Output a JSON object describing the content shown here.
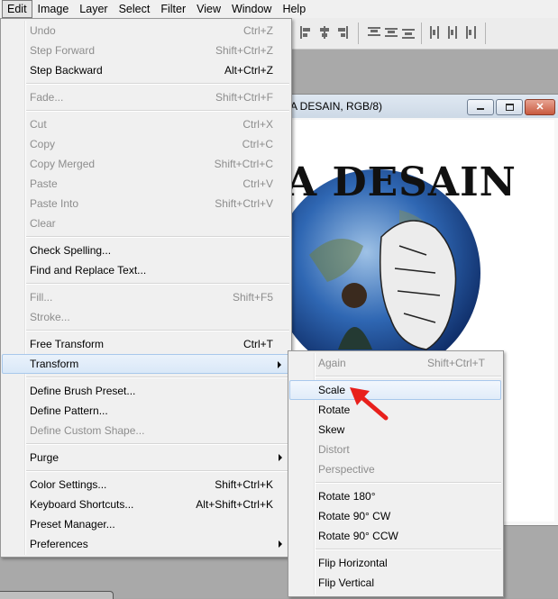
{
  "menubar": {
    "items": [
      "Edit",
      "Image",
      "Layer",
      "Select",
      "Filter",
      "View",
      "Window",
      "Help"
    ]
  },
  "document": {
    "title": "A DESAIN, RGB/8)",
    "artwork_text": "A DESAIN"
  },
  "edit_menu": {
    "items": [
      {
        "label": "Undo",
        "shortcut": "Ctrl+Z",
        "disabled": true
      },
      {
        "label": "Step Forward",
        "shortcut": "Shift+Ctrl+Z",
        "disabled": true
      },
      {
        "label": "Step Backward",
        "shortcut": "Alt+Ctrl+Z",
        "disabled": false
      },
      {
        "label": "Fade...",
        "shortcut": "Shift+Ctrl+F",
        "disabled": true
      },
      {
        "label": "Cut",
        "shortcut": "Ctrl+X",
        "disabled": true
      },
      {
        "label": "Copy",
        "shortcut": "Ctrl+C",
        "disabled": true
      },
      {
        "label": "Copy Merged",
        "shortcut": "Shift+Ctrl+C",
        "disabled": true
      },
      {
        "label": "Paste",
        "shortcut": "Ctrl+V",
        "disabled": true
      },
      {
        "label": "Paste Into",
        "shortcut": "Shift+Ctrl+V",
        "disabled": true
      },
      {
        "label": "Clear",
        "shortcut": "",
        "disabled": true
      },
      {
        "label": "Check Spelling...",
        "shortcut": "",
        "disabled": false
      },
      {
        "label": "Find and Replace Text...",
        "shortcut": "",
        "disabled": false
      },
      {
        "label": "Fill...",
        "shortcut": "Shift+F5",
        "disabled": true
      },
      {
        "label": "Stroke...",
        "shortcut": "",
        "disabled": true
      },
      {
        "label": "Free Transform",
        "shortcut": "Ctrl+T",
        "disabled": false
      },
      {
        "label": "Transform",
        "shortcut": "",
        "disabled": false
      },
      {
        "label": "Define Brush Preset...",
        "shortcut": "",
        "disabled": false
      },
      {
        "label": "Define Pattern...",
        "shortcut": "",
        "disabled": false
      },
      {
        "label": "Define Custom Shape...",
        "shortcut": "",
        "disabled": true
      },
      {
        "label": "Purge",
        "shortcut": "",
        "disabled": false
      },
      {
        "label": "Color Settings...",
        "shortcut": "Shift+Ctrl+K",
        "disabled": false
      },
      {
        "label": "Keyboard Shortcuts...",
        "shortcut": "Alt+Shift+Ctrl+K",
        "disabled": false
      },
      {
        "label": "Preset Manager...",
        "shortcut": "",
        "disabled": false
      },
      {
        "label": "Preferences",
        "shortcut": "",
        "disabled": false
      }
    ]
  },
  "transform_menu": {
    "items": [
      {
        "label": "Again",
        "shortcut": "Shift+Ctrl+T",
        "disabled": true
      },
      {
        "label": "Scale",
        "shortcut": "",
        "disabled": false
      },
      {
        "label": "Rotate",
        "shortcut": "",
        "disabled": false
      },
      {
        "label": "Skew",
        "shortcut": "",
        "disabled": false
      },
      {
        "label": "Distort",
        "shortcut": "",
        "disabled": true
      },
      {
        "label": "Perspective",
        "shortcut": "",
        "disabled": true
      },
      {
        "label": "Rotate 180°",
        "shortcut": "",
        "disabled": false
      },
      {
        "label": "Rotate 90° CW",
        "shortcut": "",
        "disabled": false
      },
      {
        "label": "Rotate 90° CCW",
        "shortcut": "",
        "disabled": false
      },
      {
        "label": "Flip Horizontal",
        "shortcut": "",
        "disabled": false
      },
      {
        "label": "Flip Vertical",
        "shortcut": "",
        "disabled": false
      }
    ]
  },
  "colors": {
    "annotation_arrow": "#e8201c",
    "close_button": "#c85a3f"
  }
}
